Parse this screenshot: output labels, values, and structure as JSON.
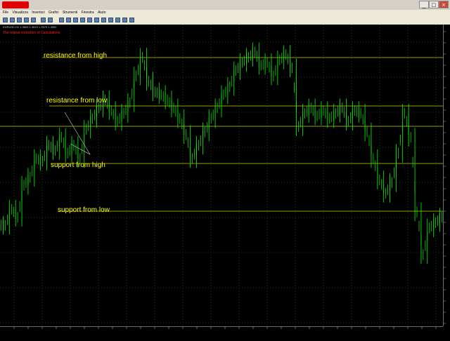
{
  "window": {
    "title_hidden": true,
    "buttons": [
      "_",
      "□",
      "×"
    ]
  },
  "menu": {
    "items": [
      "File",
      "Visualizza",
      "Inserisci",
      "Grafici",
      "Strumenti",
      "Finestra",
      "Aiuto"
    ]
  },
  "chart": {
    "info_line": "EURUSD,H1 1.3605 1.3619 1.3575 1.3592",
    "warning": "The repeat restriction of Calculations",
    "levels": [
      {
        "label": "resistance from high",
        "color": "#d0d000"
      },
      {
        "label": "resistance from low",
        "color": "#d0d000"
      },
      {
        "label": "",
        "color": "#d0d000"
      },
      {
        "label": "support from high",
        "color": "#d0d000"
      },
      {
        "label": "support from low",
        "color": "#d0d000"
      }
    ],
    "candle_color": "#00ff00",
    "grid_color": "#1a3a1a"
  },
  "chart_data": {
    "type": "line",
    "title": "",
    "xlabel": "",
    "ylabel": "",
    "series": [
      {
        "values": [
          0.3,
          0.36,
          0.33,
          0.45,
          0.48,
          0.55,
          0.54,
          0.6,
          0.58,
          0.63,
          0.57,
          0.6,
          0.55,
          0.66,
          0.7,
          0.74,
          0.77,
          0.73,
          0.69,
          0.72,
          0.76,
          0.86,
          0.93,
          0.84,
          0.8,
          0.79,
          0.77,
          0.74,
          0.7,
          0.64,
          0.55,
          0.6,
          0.65,
          0.7,
          0.74,
          0.79,
          0.82,
          0.88,
          0.91,
          0.93,
          0.95,
          0.9,
          0.91,
          0.86,
          0.92,
          0.94,
          0.89,
          0.67,
          0.72,
          0.74,
          0.71,
          0.73,
          0.7,
          0.72,
          0.74,
          0.69,
          0.73,
          0.72,
          0.65,
          0.55,
          0.47,
          0.42,
          0.46,
          0.57,
          0.72,
          0.63,
          0.35,
          0.19,
          0.29,
          0.31,
          0.33
        ]
      }
    ]
  }
}
